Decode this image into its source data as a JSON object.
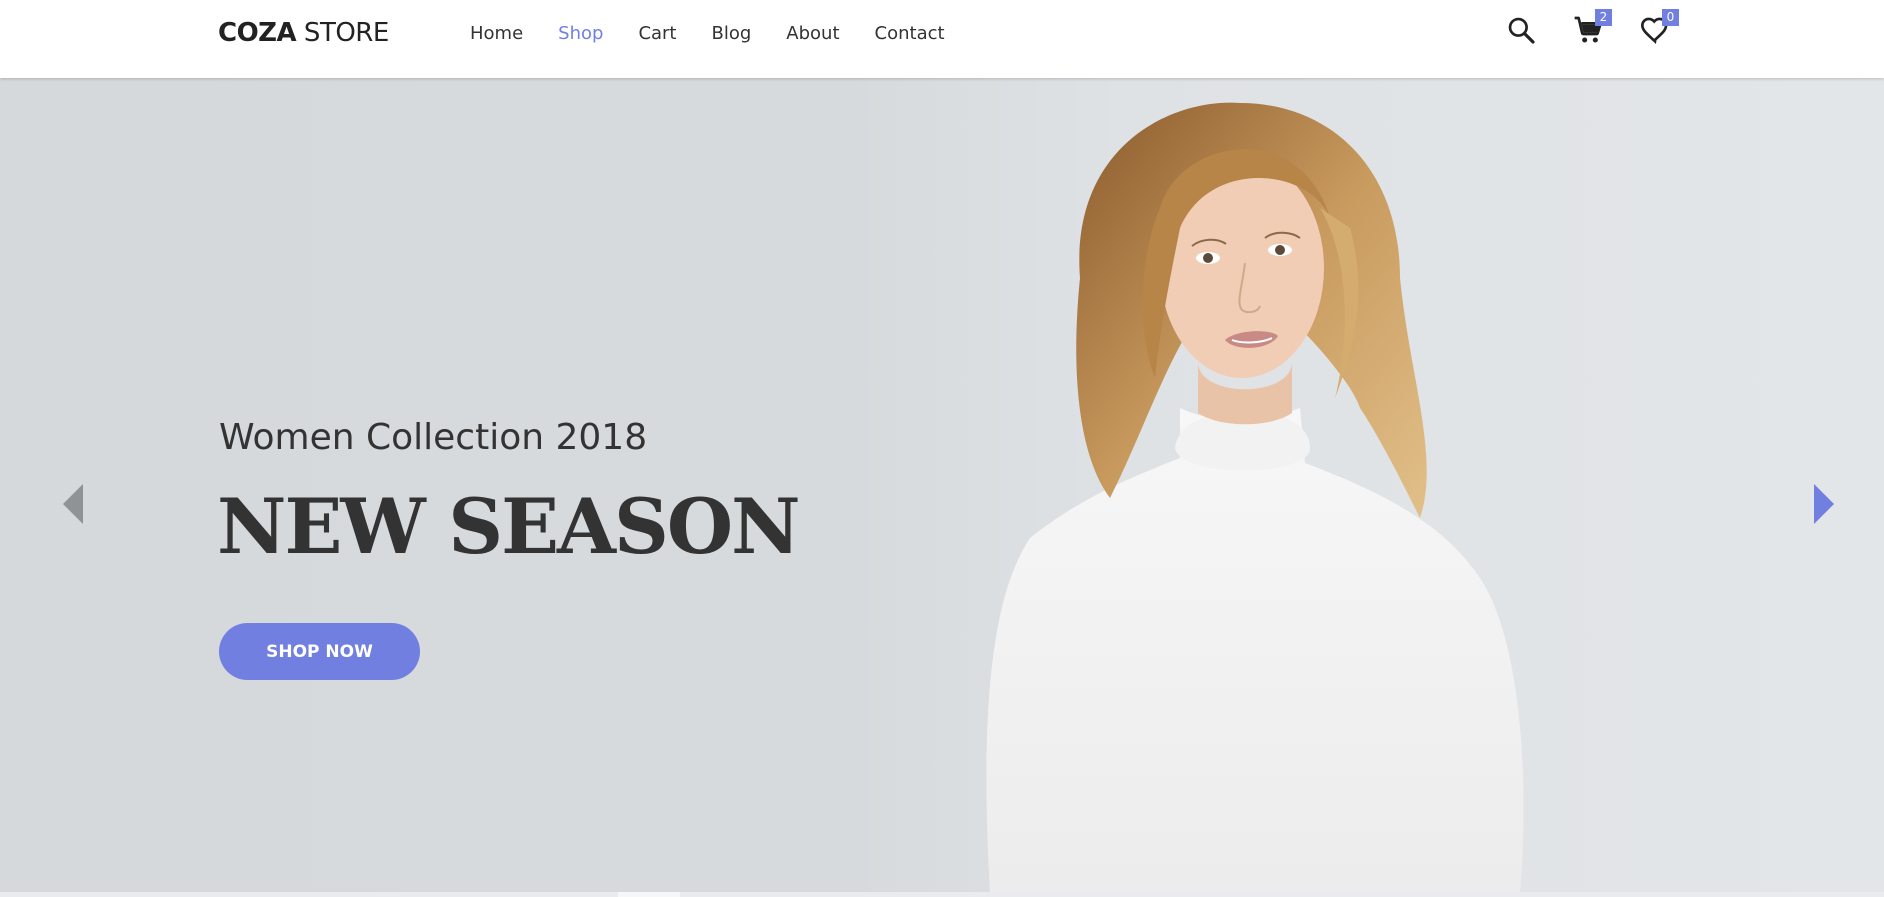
{
  "header": {
    "logo_bold": "COZA",
    "logo_light": " STORE",
    "nav": [
      "Home",
      "Shop",
      "Cart",
      "Blog",
      "About",
      "Contact"
    ],
    "active_nav": "Shop",
    "icons": {
      "search": "search-icon",
      "cart": "cart-icon",
      "wishlist": "heart-icon"
    },
    "cart_count": "2",
    "wishlist_count": "0"
  },
  "hero": {
    "subtitle": "Women Collection 2018",
    "title": "NEW SEASON",
    "button_label": "SHOP NOW",
    "prev_icon": "arrow-left-icon",
    "next_icon": "arrow-right-icon"
  },
  "colors": {
    "accent": "#717fe0",
    "text": "#333333",
    "hero_bg": "#d6dadd"
  }
}
